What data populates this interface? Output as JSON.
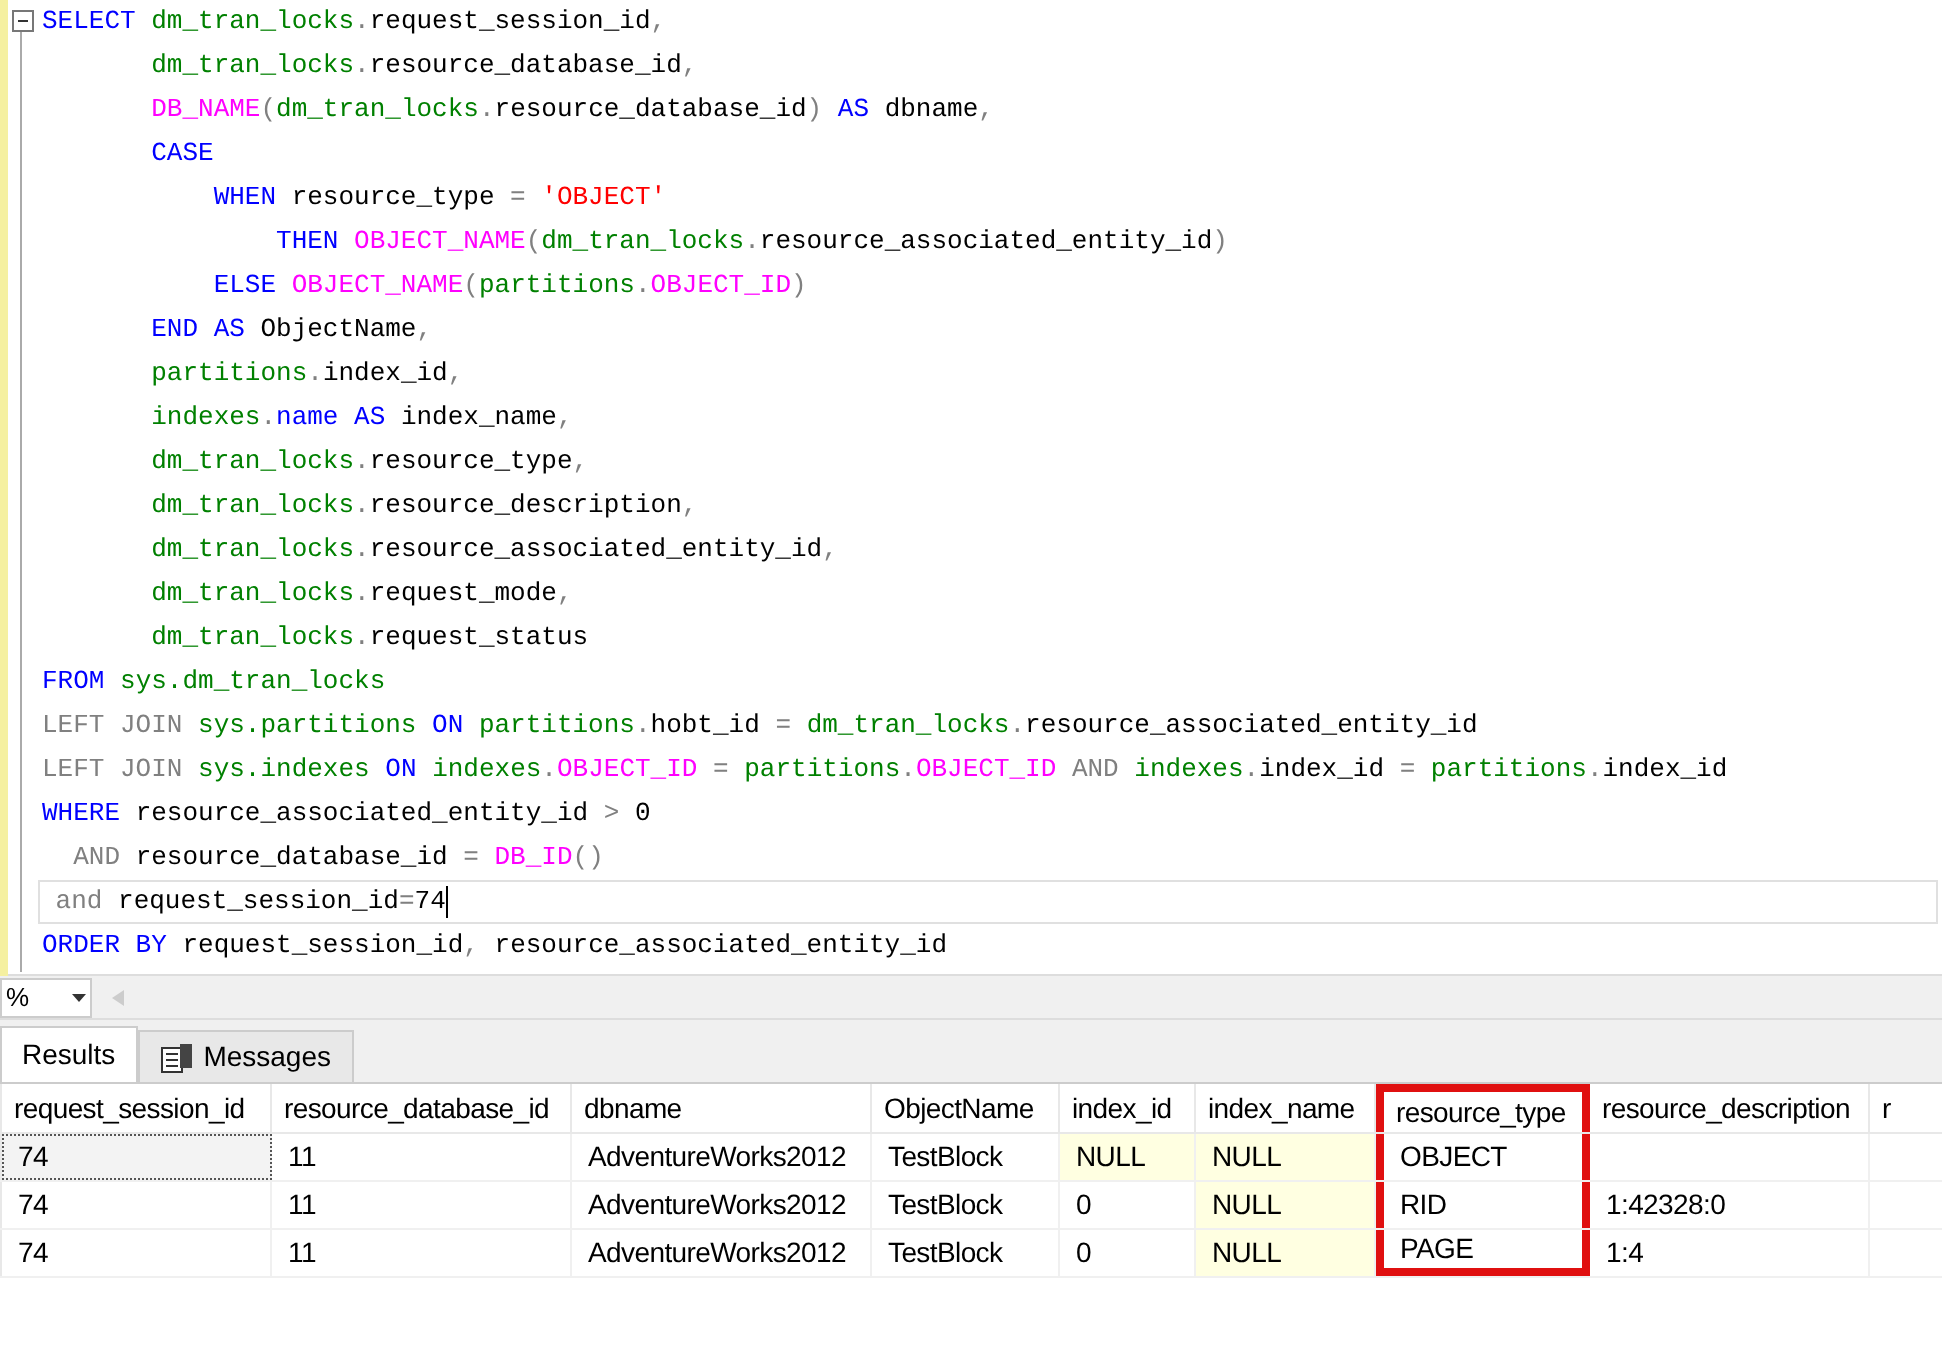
{
  "editor": {
    "lines": [
      {
        "current": false,
        "tokens": [
          {
            "kind": "keyword",
            "text": "SELECT "
          },
          {
            "kind": "object",
            "text": "dm_tran_locks"
          },
          {
            "kind": "op",
            "text": "."
          },
          {
            "kind": "plain",
            "text": "request_session_id"
          },
          {
            "kind": "op",
            "text": ","
          }
        ]
      },
      {
        "current": false,
        "tokens": [
          {
            "kind": "object",
            "text": "       dm_tran_locks"
          },
          {
            "kind": "op",
            "text": "."
          },
          {
            "kind": "plain",
            "text": "resource_database_id"
          },
          {
            "kind": "op",
            "text": ","
          }
        ]
      },
      {
        "current": false,
        "tokens": [
          {
            "kind": "function",
            "text": "       DB_NAME"
          },
          {
            "kind": "op",
            "text": "("
          },
          {
            "kind": "object",
            "text": "dm_tran_locks"
          },
          {
            "kind": "op",
            "text": "."
          },
          {
            "kind": "plain",
            "text": "resource_database_id"
          },
          {
            "kind": "op",
            "text": ")"
          },
          {
            "kind": "keyword",
            "text": " AS "
          },
          {
            "kind": "plain",
            "text": "dbname"
          },
          {
            "kind": "op",
            "text": ","
          }
        ]
      },
      {
        "current": false,
        "tokens": [
          {
            "kind": "keyword",
            "text": "       CASE"
          }
        ]
      },
      {
        "current": false,
        "tokens": [
          {
            "kind": "keyword",
            "text": "           WHEN "
          },
          {
            "kind": "plain",
            "text": "resource_type "
          },
          {
            "kind": "op",
            "text": "= "
          },
          {
            "kind": "string",
            "text": "'OBJECT'"
          }
        ]
      },
      {
        "current": false,
        "tokens": [
          {
            "kind": "keyword",
            "text": "               THEN "
          },
          {
            "kind": "function",
            "text": "OBJECT_NAME"
          },
          {
            "kind": "op",
            "text": "("
          },
          {
            "kind": "object",
            "text": "dm_tran_locks"
          },
          {
            "kind": "op",
            "text": "."
          },
          {
            "kind": "plain",
            "text": "resource_associated_entity_id"
          },
          {
            "kind": "op",
            "text": ")"
          }
        ]
      },
      {
        "current": false,
        "tokens": [
          {
            "kind": "keyword",
            "text": "           ELSE "
          },
          {
            "kind": "function",
            "text": "OBJECT_NAME"
          },
          {
            "kind": "op",
            "text": "("
          },
          {
            "kind": "object",
            "text": "partitions"
          },
          {
            "kind": "op",
            "text": "."
          },
          {
            "kind": "function",
            "text": "OBJECT_ID"
          },
          {
            "kind": "op",
            "text": ")"
          }
        ]
      },
      {
        "current": false,
        "tokens": [
          {
            "kind": "keyword",
            "text": "       END AS "
          },
          {
            "kind": "plain",
            "text": "ObjectName"
          },
          {
            "kind": "op",
            "text": ","
          }
        ]
      },
      {
        "current": false,
        "tokens": [
          {
            "kind": "object",
            "text": "       partitions"
          },
          {
            "kind": "op",
            "text": "."
          },
          {
            "kind": "plain",
            "text": "index_id"
          },
          {
            "kind": "op",
            "text": ","
          }
        ]
      },
      {
        "current": false,
        "tokens": [
          {
            "kind": "object",
            "text": "       indexes"
          },
          {
            "kind": "op",
            "text": "."
          },
          {
            "kind": "keyword",
            "text": "name AS "
          },
          {
            "kind": "plain",
            "text": "index_name"
          },
          {
            "kind": "op",
            "text": ","
          }
        ]
      },
      {
        "current": false,
        "tokens": [
          {
            "kind": "object",
            "text": "       dm_tran_locks"
          },
          {
            "kind": "op",
            "text": "."
          },
          {
            "kind": "plain",
            "text": "resource_type"
          },
          {
            "kind": "op",
            "text": ","
          }
        ]
      },
      {
        "current": false,
        "tokens": [
          {
            "kind": "object",
            "text": "       dm_tran_locks"
          },
          {
            "kind": "op",
            "text": "."
          },
          {
            "kind": "plain",
            "text": "resource_description"
          },
          {
            "kind": "op",
            "text": ","
          }
        ]
      },
      {
        "current": false,
        "tokens": [
          {
            "kind": "object",
            "text": "       dm_tran_locks"
          },
          {
            "kind": "op",
            "text": "."
          },
          {
            "kind": "plain",
            "text": "resource_associated_entity_id"
          },
          {
            "kind": "op",
            "text": ","
          }
        ]
      },
      {
        "current": false,
        "tokens": [
          {
            "kind": "object",
            "text": "       dm_tran_locks"
          },
          {
            "kind": "op",
            "text": "."
          },
          {
            "kind": "plain",
            "text": "request_mode"
          },
          {
            "kind": "op",
            "text": ","
          }
        ]
      },
      {
        "current": false,
        "tokens": [
          {
            "kind": "object",
            "text": "       dm_tran_locks"
          },
          {
            "kind": "op",
            "text": "."
          },
          {
            "kind": "plain",
            "text": "request_status"
          }
        ]
      },
      {
        "current": false,
        "tokens": [
          {
            "kind": "keyword",
            "text": "FROM "
          },
          {
            "kind": "object",
            "text": "sys.dm_tran_locks"
          }
        ]
      },
      {
        "current": false,
        "tokens": [
          {
            "kind": "op",
            "text": "LEFT JOIN "
          },
          {
            "kind": "object",
            "text": "sys.partitions"
          },
          {
            "kind": "keyword",
            "text": " ON "
          },
          {
            "kind": "object",
            "text": "partitions"
          },
          {
            "kind": "op",
            "text": "."
          },
          {
            "kind": "plain",
            "text": "hobt_id "
          },
          {
            "kind": "op",
            "text": "= "
          },
          {
            "kind": "object",
            "text": "dm_tran_locks"
          },
          {
            "kind": "op",
            "text": "."
          },
          {
            "kind": "plain",
            "text": "resource_associated_entity_id"
          }
        ]
      },
      {
        "current": false,
        "tokens": [
          {
            "kind": "op",
            "text": "LEFT JOIN "
          },
          {
            "kind": "object",
            "text": "sys.indexes"
          },
          {
            "kind": "keyword",
            "text": " ON "
          },
          {
            "kind": "object",
            "text": "indexes"
          },
          {
            "kind": "op",
            "text": "."
          },
          {
            "kind": "function",
            "text": "OBJECT_ID"
          },
          {
            "kind": "op",
            "text": " = "
          },
          {
            "kind": "object",
            "text": "partitions"
          },
          {
            "kind": "op",
            "text": "."
          },
          {
            "kind": "function",
            "text": "OBJECT_ID"
          },
          {
            "kind": "op",
            "text": " AND "
          },
          {
            "kind": "object",
            "text": "indexes"
          },
          {
            "kind": "op",
            "text": "."
          },
          {
            "kind": "plain",
            "text": "index_id "
          },
          {
            "kind": "op",
            "text": "= "
          },
          {
            "kind": "object",
            "text": "partitions"
          },
          {
            "kind": "op",
            "text": "."
          },
          {
            "kind": "plain",
            "text": "index_id"
          }
        ]
      },
      {
        "current": false,
        "tokens": [
          {
            "kind": "keyword",
            "text": "WHERE "
          },
          {
            "kind": "plain",
            "text": "resource_associated_entity_id "
          },
          {
            "kind": "op",
            "text": "> "
          },
          {
            "kind": "plain",
            "text": "0"
          }
        ]
      },
      {
        "current": false,
        "tokens": [
          {
            "kind": "op",
            "text": "  AND "
          },
          {
            "kind": "plain",
            "text": "resource_database_id "
          },
          {
            "kind": "op",
            "text": "= "
          },
          {
            "kind": "function",
            "text": "DB_ID"
          },
          {
            "kind": "op",
            "text": "()"
          }
        ]
      },
      {
        "current": true,
        "tokens": [
          {
            "kind": "op",
            "text": " and "
          },
          {
            "kind": "plain",
            "text": "request_session_id"
          },
          {
            "kind": "op",
            "text": "="
          },
          {
            "kind": "plain",
            "text": "74"
          }
        ]
      },
      {
        "current": false,
        "tokens": [
          {
            "kind": "keyword",
            "text": "ORDER BY "
          },
          {
            "kind": "plain",
            "text": "request_session_id"
          },
          {
            "kind": "op",
            "text": ", "
          },
          {
            "kind": "plain",
            "text": "resource_associated_entity_id"
          }
        ]
      }
    ]
  },
  "zoom": {
    "value": "%"
  },
  "tabs": [
    {
      "label": "Results",
      "selected": true,
      "kind": "grid"
    },
    {
      "label": "Messages",
      "selected": false,
      "kind": "messages"
    }
  ],
  "grid": {
    "columns": [
      {
        "label": "request_session_id",
        "highlighted": false
      },
      {
        "label": "resource_database_id",
        "highlighted": false
      },
      {
        "label": "dbname",
        "highlighted": false
      },
      {
        "label": "ObjectName",
        "highlighted": false
      },
      {
        "label": "index_id",
        "highlighted": false
      },
      {
        "label": "index_name",
        "highlighted": false
      },
      {
        "label": "resource_type",
        "highlighted": true
      },
      {
        "label": "resource_description",
        "highlighted": false
      },
      {
        "label": "r",
        "highlighted": false
      }
    ],
    "rows": [
      {
        "focused": true,
        "cells": [
          {
            "text": "74",
            "null": false
          },
          {
            "text": "11",
            "null": false
          },
          {
            "text": "AdventureWorks2012",
            "null": false
          },
          {
            "text": "TestBlock",
            "null": false
          },
          {
            "text": "NULL",
            "null": true
          },
          {
            "text": "NULL",
            "null": true
          },
          {
            "text": "OBJECT",
            "null": false
          }
        ]
      },
      {
        "focused": false,
        "cells": [
          {
            "text": "74",
            "null": false
          },
          {
            "text": "11",
            "null": false
          },
          {
            "text": "AdventureWorks2012",
            "null": false
          },
          {
            "text": "TestBlock",
            "null": false
          },
          {
            "text": "0",
            "null": false
          },
          {
            "text": "NULL",
            "null": true
          },
          {
            "text": "RID",
            "null": false
          },
          {
            "text": "1:42328:0",
            "null": false
          }
        ]
      },
      {
        "focused": false,
        "cells": [
          {
            "text": "74",
            "null": false
          },
          {
            "text": "11",
            "null": false
          },
          {
            "text": "AdventureWorks2012",
            "null": false
          },
          {
            "text": "TestBlock",
            "null": false
          },
          {
            "text": "0",
            "null": false
          },
          {
            "text": "NULL",
            "null": true
          },
          {
            "text": "PAGE",
            "null": false
          },
          {
            "text": "1:4",
            "null": false
          }
        ]
      }
    ]
  }
}
